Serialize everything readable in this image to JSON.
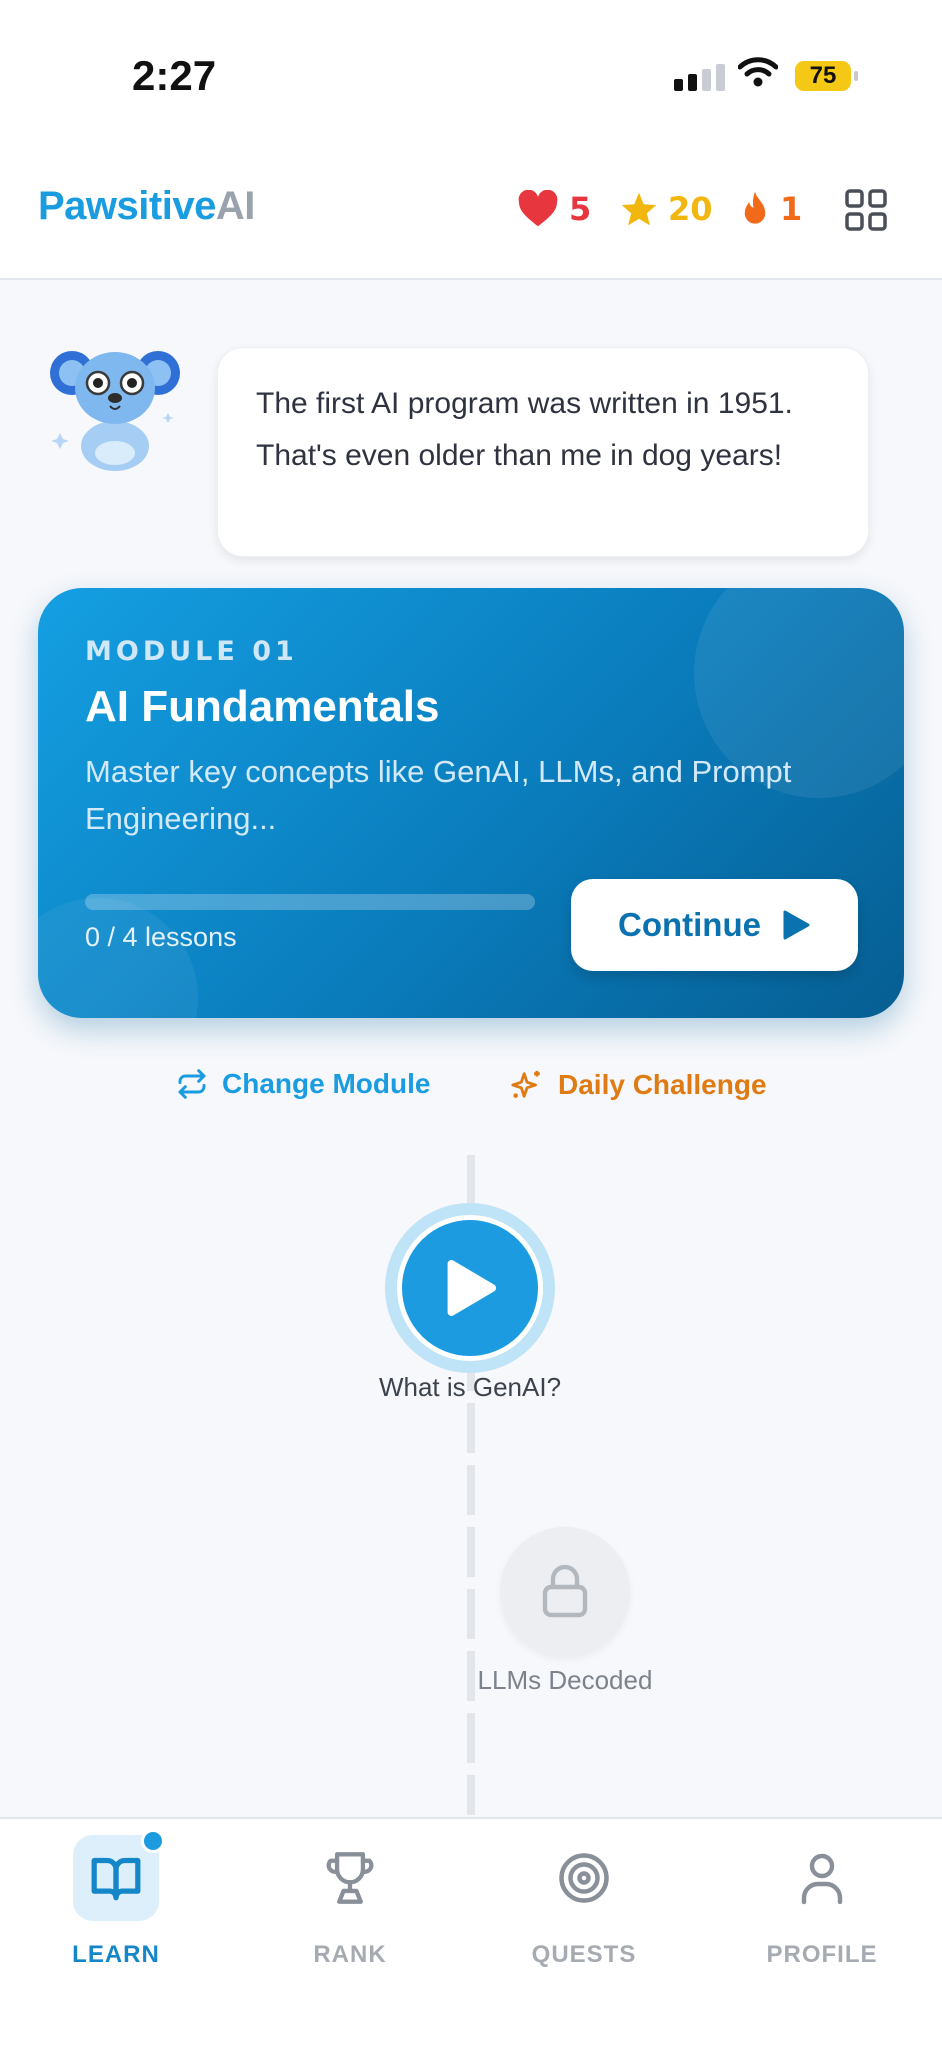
{
  "status_bar": {
    "time": "2:27",
    "battery": "75"
  },
  "header": {
    "logo_part1": "Pawsitive",
    "logo_part2": "AI",
    "hearts": "5",
    "stars": "20",
    "streak": "1",
    "colors": {
      "brand": "#1a9ce0",
      "hearts": "#e8363f",
      "stars": "#f2b70f",
      "streak": "#f06a1a"
    }
  },
  "mascot": {
    "fact": "The first AI program was written in 1951. That's even older than me in dog years!"
  },
  "module": {
    "label": "MODULE 01",
    "title": "AI Fundamentals",
    "description": "Master key concepts like GenAI, LLMs, and Prompt Engineering...",
    "progress_text": "0 / 4 lessons",
    "progress_fraction": 0,
    "continue_label": "Continue"
  },
  "actions": {
    "change_module": "Change Module",
    "daily_challenge": "Daily Challenge"
  },
  "lessons": [
    {
      "title": "What is GenAI?",
      "state": "active"
    },
    {
      "title": "LLMs Decoded",
      "state": "locked"
    }
  ],
  "tabs": [
    {
      "label": "LEARN",
      "active": true,
      "icon": "book-icon"
    },
    {
      "label": "RANK",
      "active": false,
      "icon": "trophy-icon"
    },
    {
      "label": "QUESTS",
      "active": false,
      "icon": "target-icon"
    },
    {
      "label": "PROFILE",
      "active": false,
      "icon": "user-icon"
    }
  ]
}
